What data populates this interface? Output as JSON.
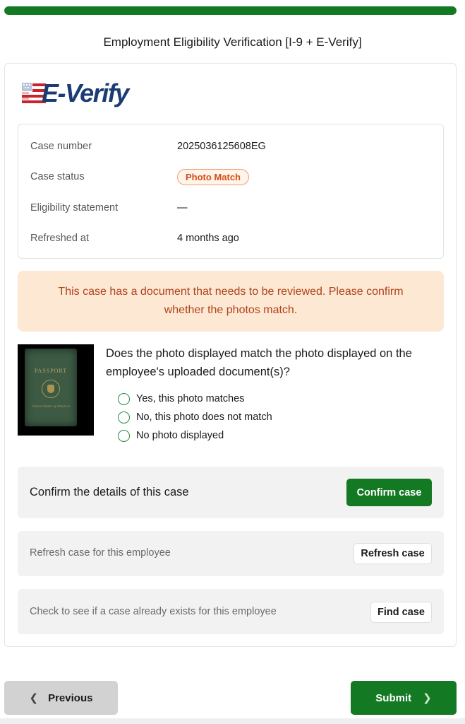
{
  "progress": {
    "fraction": 1.0,
    "color": "#137a23"
  },
  "page": {
    "title": "Employment Eligibility Verification [I-9 + E-Verify]"
  },
  "logo": {
    "text": "E-Verify",
    "icon": "everify-flag-icon"
  },
  "case": {
    "number_label": "Case number",
    "number": "2025036125608EG",
    "status_label": "Case status",
    "status": "Photo Match",
    "eligibility_label": "Eligibility statement",
    "eligibility": "—",
    "refreshed_label": "Refreshed at",
    "refreshed": "4 months ago"
  },
  "alert": {
    "message": "This case has a document that needs to be reviewed. Please confirm whether the photos match."
  },
  "photo": {
    "image": "passport-photo",
    "passport_title": "PASSPORT",
    "passport_sub": "United States of America"
  },
  "question": {
    "text": "Does the photo displayed match the photo displayed on the employee's uploaded document(s)?",
    "options": [
      "Yes, this photo matches",
      "No, this photo does not match",
      "No photo displayed"
    ]
  },
  "confirm_panel": {
    "text": "Confirm the details of this case",
    "button": "Confirm case"
  },
  "refresh_panel": {
    "text": "Refresh case for this employee",
    "button": "Refresh case"
  },
  "find_panel": {
    "text": "Check to see if a case already exists for this employee",
    "button": "Find case"
  },
  "footer": {
    "previous": "Previous",
    "submit": "Submit"
  },
  "colors": {
    "primary": "#137a23",
    "alert_bg": "#fde8d4",
    "alert_text": "#b0421a",
    "badge": "#d2501a"
  }
}
